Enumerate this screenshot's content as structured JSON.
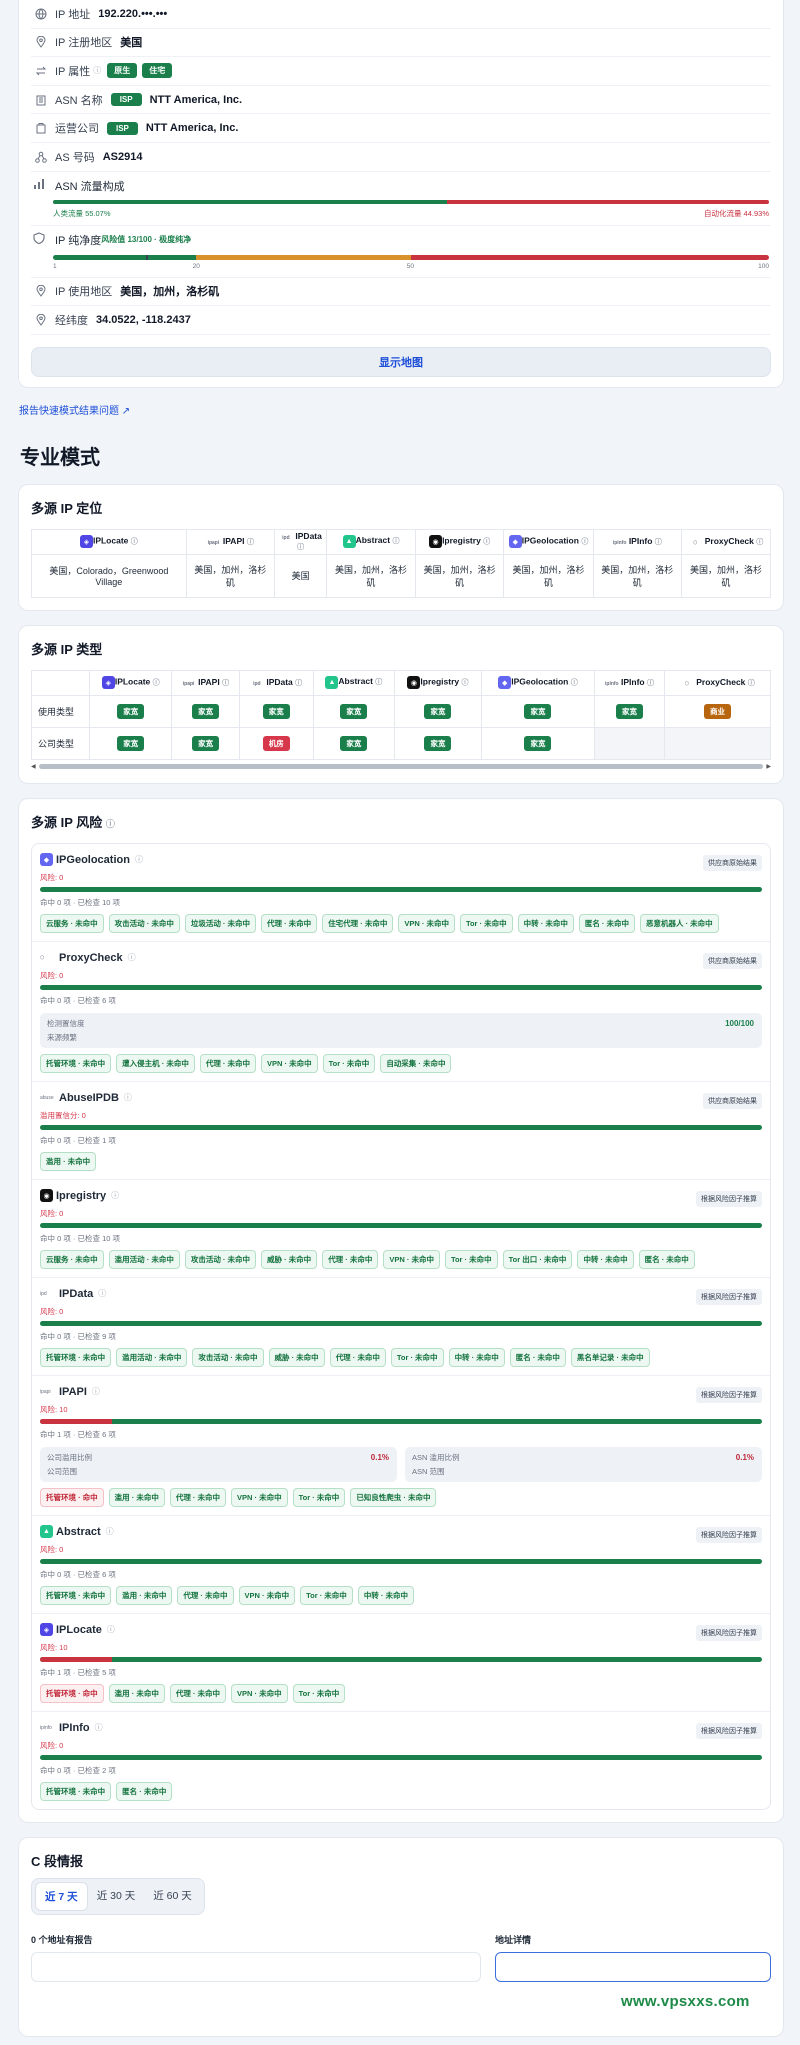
{
  "basic": {
    "rows": [
      {
        "label": "IP 地址",
        "value": "192.220.•••.•••"
      },
      {
        "label": "IP 注册地区",
        "value": "美国"
      },
      {
        "label": "IP 属性",
        "tags": [
          "原生",
          "住宅"
        ]
      },
      {
        "label": "ASN 名称",
        "tag": "ISP",
        "value": "NTT America, Inc."
      },
      {
        "label": "运营公司",
        "tag": "ISP",
        "value": "NTT America, Inc."
      },
      {
        "label": "AS 号码",
        "value": "AS2914"
      }
    ],
    "asn_flow": {
      "label": "ASN 流量构成",
      "human_label": "人类流量 55.07%",
      "bot_label": "自动化流量 44.93%",
      "human_pct": 55.07
    },
    "purity": {
      "label": "IP 纯净度",
      "score_text": "风险值 13/100 · 极度纯净",
      "score": 13,
      "ticks": [
        "1",
        "20",
        "50",
        "100"
      ]
    },
    "usage": {
      "label": "IP 使用地区",
      "value": "美国，加州，洛杉矶"
    },
    "coords": {
      "label": "经纬度",
      "value": "34.0522, -118.2437"
    },
    "map_button": "显示地图"
  },
  "report_link": "报告快速模式结果问题",
  "pro_title": "专业模式",
  "geo": {
    "title": "多源 IP 定位",
    "providers": [
      "IPLocate",
      "IPAPI",
      "IPData",
      "Abstract",
      "Ipregistry",
      "IPGeolocation",
      "IPInfo",
      "ProxyCheck"
    ],
    "values": [
      "美国，Colorado，Greenwood Village",
      "美国，加州，洛杉矶",
      "美国",
      "美国，加州，洛杉矶",
      "美国，加州，洛杉矶",
      "美国，加州，洛杉矶",
      "美国，加州，洛杉矶",
      "美国，加州，洛杉矶"
    ]
  },
  "types": {
    "title": "多源 IP 类型",
    "providers": [
      "IPLocate",
      "IPAPI",
      "IPData",
      "Abstract",
      "Ipregistry",
      "IPGeolocation",
      "IPInfo",
      "ProxyCheck"
    ],
    "rows": [
      {
        "label": "使用类型",
        "values": [
          "家宽",
          "家宽",
          "家宽",
          "家宽",
          "家宽",
          "家宽",
          "家宽",
          "商业"
        ]
      },
      {
        "label": "公司类型",
        "values": [
          "家宽",
          "家宽",
          "机房",
          "家宽",
          "家宽",
          "家宽",
          "",
          ""
        ]
      }
    ]
  },
  "risk": {
    "title": "多源 IP 风险",
    "items": [
      {
        "name": "IPGeolocation",
        "badge": "供应商原始结果",
        "score": "风险: 0",
        "pct": 0,
        "hit": "命中 0 项 · 已检查 10 项",
        "chips": [
          [
            "云服务 · 未命中",
            0
          ],
          [
            "攻击活动 · 未命中",
            0
          ],
          [
            "垃圾活动 · 未命中",
            0
          ],
          [
            "代理 · 未命中",
            0
          ],
          [
            "住宅代理 · 未命中",
            0
          ],
          [
            "VPN · 未命中",
            0
          ],
          [
            "Tor · 未命中",
            0
          ],
          [
            "中转 · 未命中",
            0
          ],
          [
            "匿名 · 未命中",
            0
          ],
          [
            "恶意机器人 · 未命中",
            0
          ]
        ]
      },
      {
        "name": "ProxyCheck",
        "badge": "供应商原始结果",
        "score": "风险: 0",
        "pct": 0,
        "hit": "命中 0 项 · 已检查 6 项",
        "box": [
          {
            "l1": "检测置信度",
            "l2": "来源频繁",
            "v": "100/100"
          }
        ],
        "chips": [
          [
            "托管环境 · 未命中",
            0
          ],
          [
            "遭入侵主机 · 未命中",
            0
          ],
          [
            "代理 · 未命中",
            0
          ],
          [
            "VPN · 未命中",
            0
          ],
          [
            "Tor · 未命中",
            0
          ],
          [
            "自动采集 · 未命中",
            0
          ]
        ]
      },
      {
        "name": "AbuseIPDB",
        "badge": "供应商原始结果",
        "score": "滥用置信分: 0",
        "pct": 0,
        "hit": "命中 0 项 · 已检查 1 项",
        "chips": [
          [
            "滥用 · 未命中",
            0
          ]
        ]
      },
      {
        "name": "Ipregistry",
        "badge": "根据风险因子推算",
        "score": "风险: 0",
        "pct": 0,
        "hit": "命中 0 项 · 已检查 10 项",
        "chips": [
          [
            "云服务 · 未命中",
            0
          ],
          [
            "滥用活动 · 未命中",
            0
          ],
          [
            "攻击活动 · 未命中",
            0
          ],
          [
            "威胁 · 未命中",
            0
          ],
          [
            "代理 · 未命中",
            0
          ],
          [
            "VPN · 未命中",
            0
          ],
          [
            "Tor · 未命中",
            0
          ],
          [
            "Tor 出口 · 未命中",
            0
          ],
          [
            "中转 · 未命中",
            0
          ],
          [
            "匿名 · 未命中",
            0
          ]
        ]
      },
      {
        "name": "IPData",
        "badge": "根据风险因子推算",
        "score": "风险: 0",
        "pct": 0,
        "hit": "命中 0 项 · 已检查 9 项",
        "chips": [
          [
            "托管环境 · 未命中",
            0
          ],
          [
            "滥用活动 · 未命中",
            0
          ],
          [
            "攻击活动 · 未命中",
            0
          ],
          [
            "威胁 · 未命中",
            0
          ],
          [
            "代理 · 未命中",
            0
          ],
          [
            "Tor · 未命中",
            0
          ],
          [
            "中转 · 未命中",
            0
          ],
          [
            "匿名 · 未命中",
            0
          ],
          [
            "黑名单记录 · 未命中",
            0
          ]
        ]
      },
      {
        "name": "IPAPI",
        "badge": "根据风险因子推算",
        "score": "风险: 10",
        "pct": 10,
        "hit": "命中 1 项 · 已检查 6 项",
        "box": [
          {
            "l1": "公司滥用比例",
            "l2": "公司范围",
            "v": "0.1%"
          },
          {
            "l1": "ASN 滥用比例",
            "l2": "ASN 范围",
            "v": "0.1%"
          }
        ],
        "chips": [
          [
            "托管环境 · 命中",
            1
          ],
          [
            "滥用 · 未命中",
            0
          ],
          [
            "代理 · 未命中",
            0
          ],
          [
            "VPN · 未命中",
            0
          ],
          [
            "Tor · 未命中",
            0
          ],
          [
            "已知良性爬虫 · 未命中",
            0
          ]
        ]
      },
      {
        "name": "Abstract",
        "badge": "根据风险因子推算",
        "score": "风险: 0",
        "pct": 0,
        "hit": "命中 0 项 · 已检查 6 项",
        "chips": [
          [
            "托管环境 · 未命中",
            0
          ],
          [
            "滥用 · 未命中",
            0
          ],
          [
            "代理 · 未命中",
            0
          ],
          [
            "VPN · 未命中",
            0
          ],
          [
            "Tor · 未命中",
            0
          ],
          [
            "中转 · 未命中",
            0
          ]
        ]
      },
      {
        "name": "IPLocate",
        "badge": "根据风险因子推算",
        "score": "风险: 10",
        "pct": 10,
        "hit": "命中 1 项 · 已检查 5 项",
        "chips": [
          [
            "托管环境 · 命中",
            1
          ],
          [
            "滥用 · 未命中",
            0
          ],
          [
            "代理 · 未命中",
            0
          ],
          [
            "VPN · 未命中",
            0
          ],
          [
            "Tor · 未命中",
            0
          ]
        ]
      },
      {
        "name": "IPInfo",
        "badge": "根据风险因子推算",
        "score": "风险: 0",
        "pct": 0,
        "hit": "命中 0 项 · 已检查 2 项",
        "chips": [
          [
            "托管环境 · 未命中",
            0
          ],
          [
            "匿名 · 未命中",
            0
          ]
        ]
      }
    ]
  },
  "cseg": {
    "title": "C 段情报",
    "tabs": [
      "近 7 天",
      "近 30 天",
      "近 60 天"
    ],
    "active": 0,
    "count_text": "0 个地址有报告",
    "detail_label": "地址详情"
  },
  "watermark": "www.vpsxxs.com"
}
